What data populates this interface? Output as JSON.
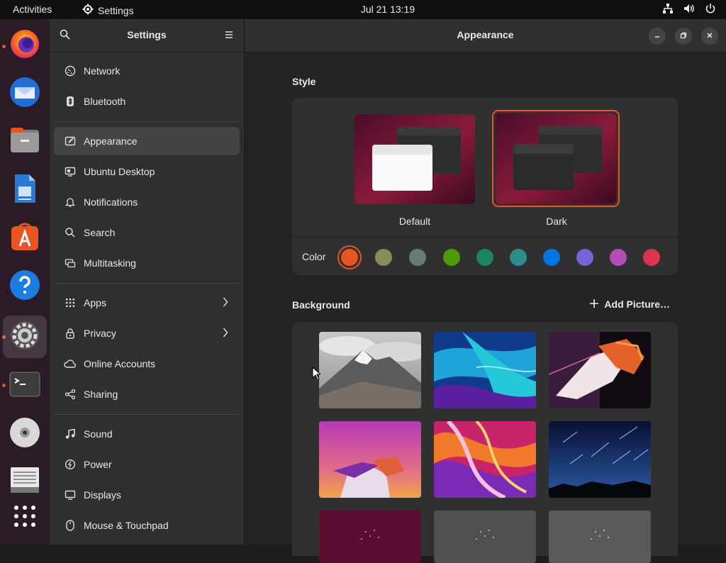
{
  "topbar": {
    "activities": "Activities",
    "app_name": "Settings",
    "clock": "Jul 21  13:19"
  },
  "dock": {
    "items": [
      {
        "name": "firefox-icon",
        "running": true
      },
      {
        "name": "thunderbird-icon",
        "running": false
      },
      {
        "name": "files-icon",
        "running": false
      },
      {
        "name": "libreoffice-writer-icon",
        "running": false
      },
      {
        "name": "app-center-icon",
        "running": false
      },
      {
        "name": "help-icon",
        "running": false
      },
      {
        "name": "settings-icon",
        "running": true
      },
      {
        "name": "terminal-icon",
        "running": true
      },
      {
        "name": "disc-icon",
        "running": false
      },
      {
        "name": "text-editor-icon",
        "running": false
      },
      {
        "name": "show-apps-icon",
        "running": false
      }
    ]
  },
  "sidebar": {
    "title": "Settings",
    "items": [
      {
        "label": "Network",
        "icon": "network-icon"
      },
      {
        "label": "Bluetooth",
        "icon": "bluetooth-icon"
      },
      {
        "label": "Appearance",
        "icon": "appearance-icon",
        "selected": true
      },
      {
        "label": "Ubuntu Desktop",
        "icon": "ubuntu-desktop-icon"
      },
      {
        "label": "Notifications",
        "icon": "bell-icon"
      },
      {
        "label": "Search",
        "icon": "search-icon"
      },
      {
        "label": "Multitasking",
        "icon": "multitasking-icon"
      },
      {
        "label": "Apps",
        "icon": "apps-grid-icon",
        "chevron": true
      },
      {
        "label": "Privacy",
        "icon": "lock-icon",
        "chevron": true
      },
      {
        "label": "Online Accounts",
        "icon": "cloud-icon"
      },
      {
        "label": "Sharing",
        "icon": "share-icon"
      },
      {
        "label": "Sound",
        "icon": "music-note-icon"
      },
      {
        "label": "Power",
        "icon": "power-icon"
      },
      {
        "label": "Displays",
        "icon": "display-icon"
      },
      {
        "label": "Mouse & Touchpad",
        "icon": "mouse-icon"
      }
    ]
  },
  "main": {
    "title": "Appearance",
    "style_section": "Style",
    "style_default": "Default",
    "style_dark": "Dark",
    "selected_style": "Dark",
    "color_label": "Color",
    "colors": [
      "#e95420",
      "#8a8a5c",
      "#6a7c71",
      "#4e9a06",
      "#18875f",
      "#2c8d8d",
      "#0073e5",
      "#7764d8",
      "#b34cb3",
      "#da3450"
    ],
    "selected_color": "#e95420",
    "background_section": "Background",
    "add_picture": "Add Picture…",
    "accent": "#e95420"
  }
}
